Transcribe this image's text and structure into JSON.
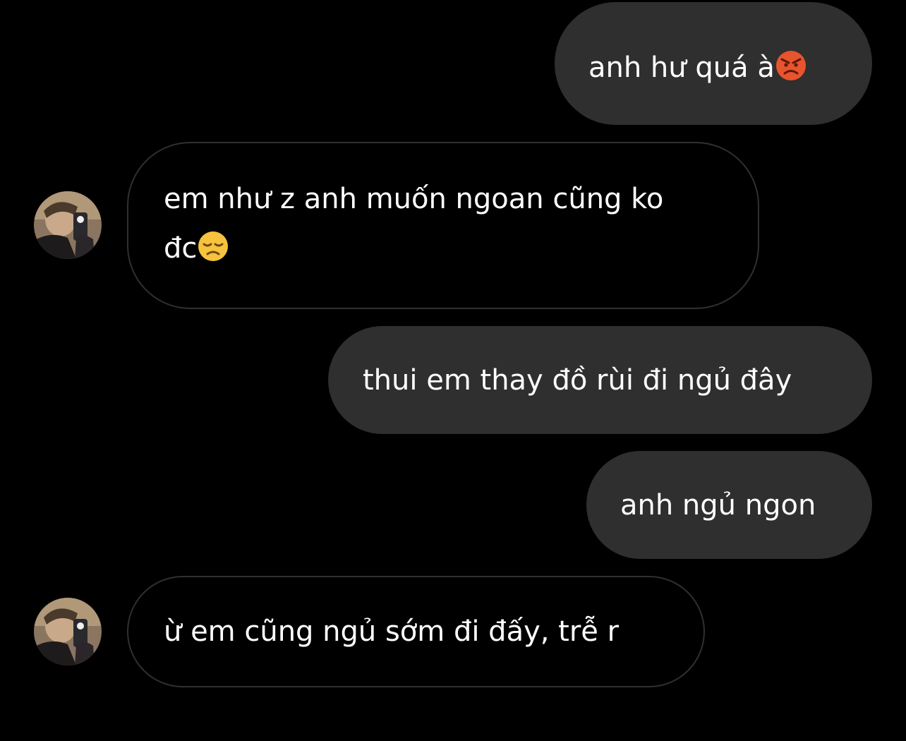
{
  "thread": {
    "messages": [
      {
        "side": "sent",
        "text": "anh hư quá à",
        "emoji": "angry-face"
      },
      {
        "side": "received",
        "line1": "em như z anh muốn ngoan cũng ko",
        "line2": "đc",
        "emoji": "disappointed-face"
      },
      {
        "side": "sent",
        "text": "thui em thay đồ rùi đi ngủ đây"
      },
      {
        "side": "sent",
        "text": "anh ngủ ngon"
      },
      {
        "side": "received",
        "text": "ừ em cũng ngủ sớm đi đấy, trễ r"
      }
    ]
  },
  "colors": {
    "background": "#000000",
    "sent_bubble": "#2f2f2f",
    "received_border": "#303030",
    "text": "#ffffff"
  }
}
